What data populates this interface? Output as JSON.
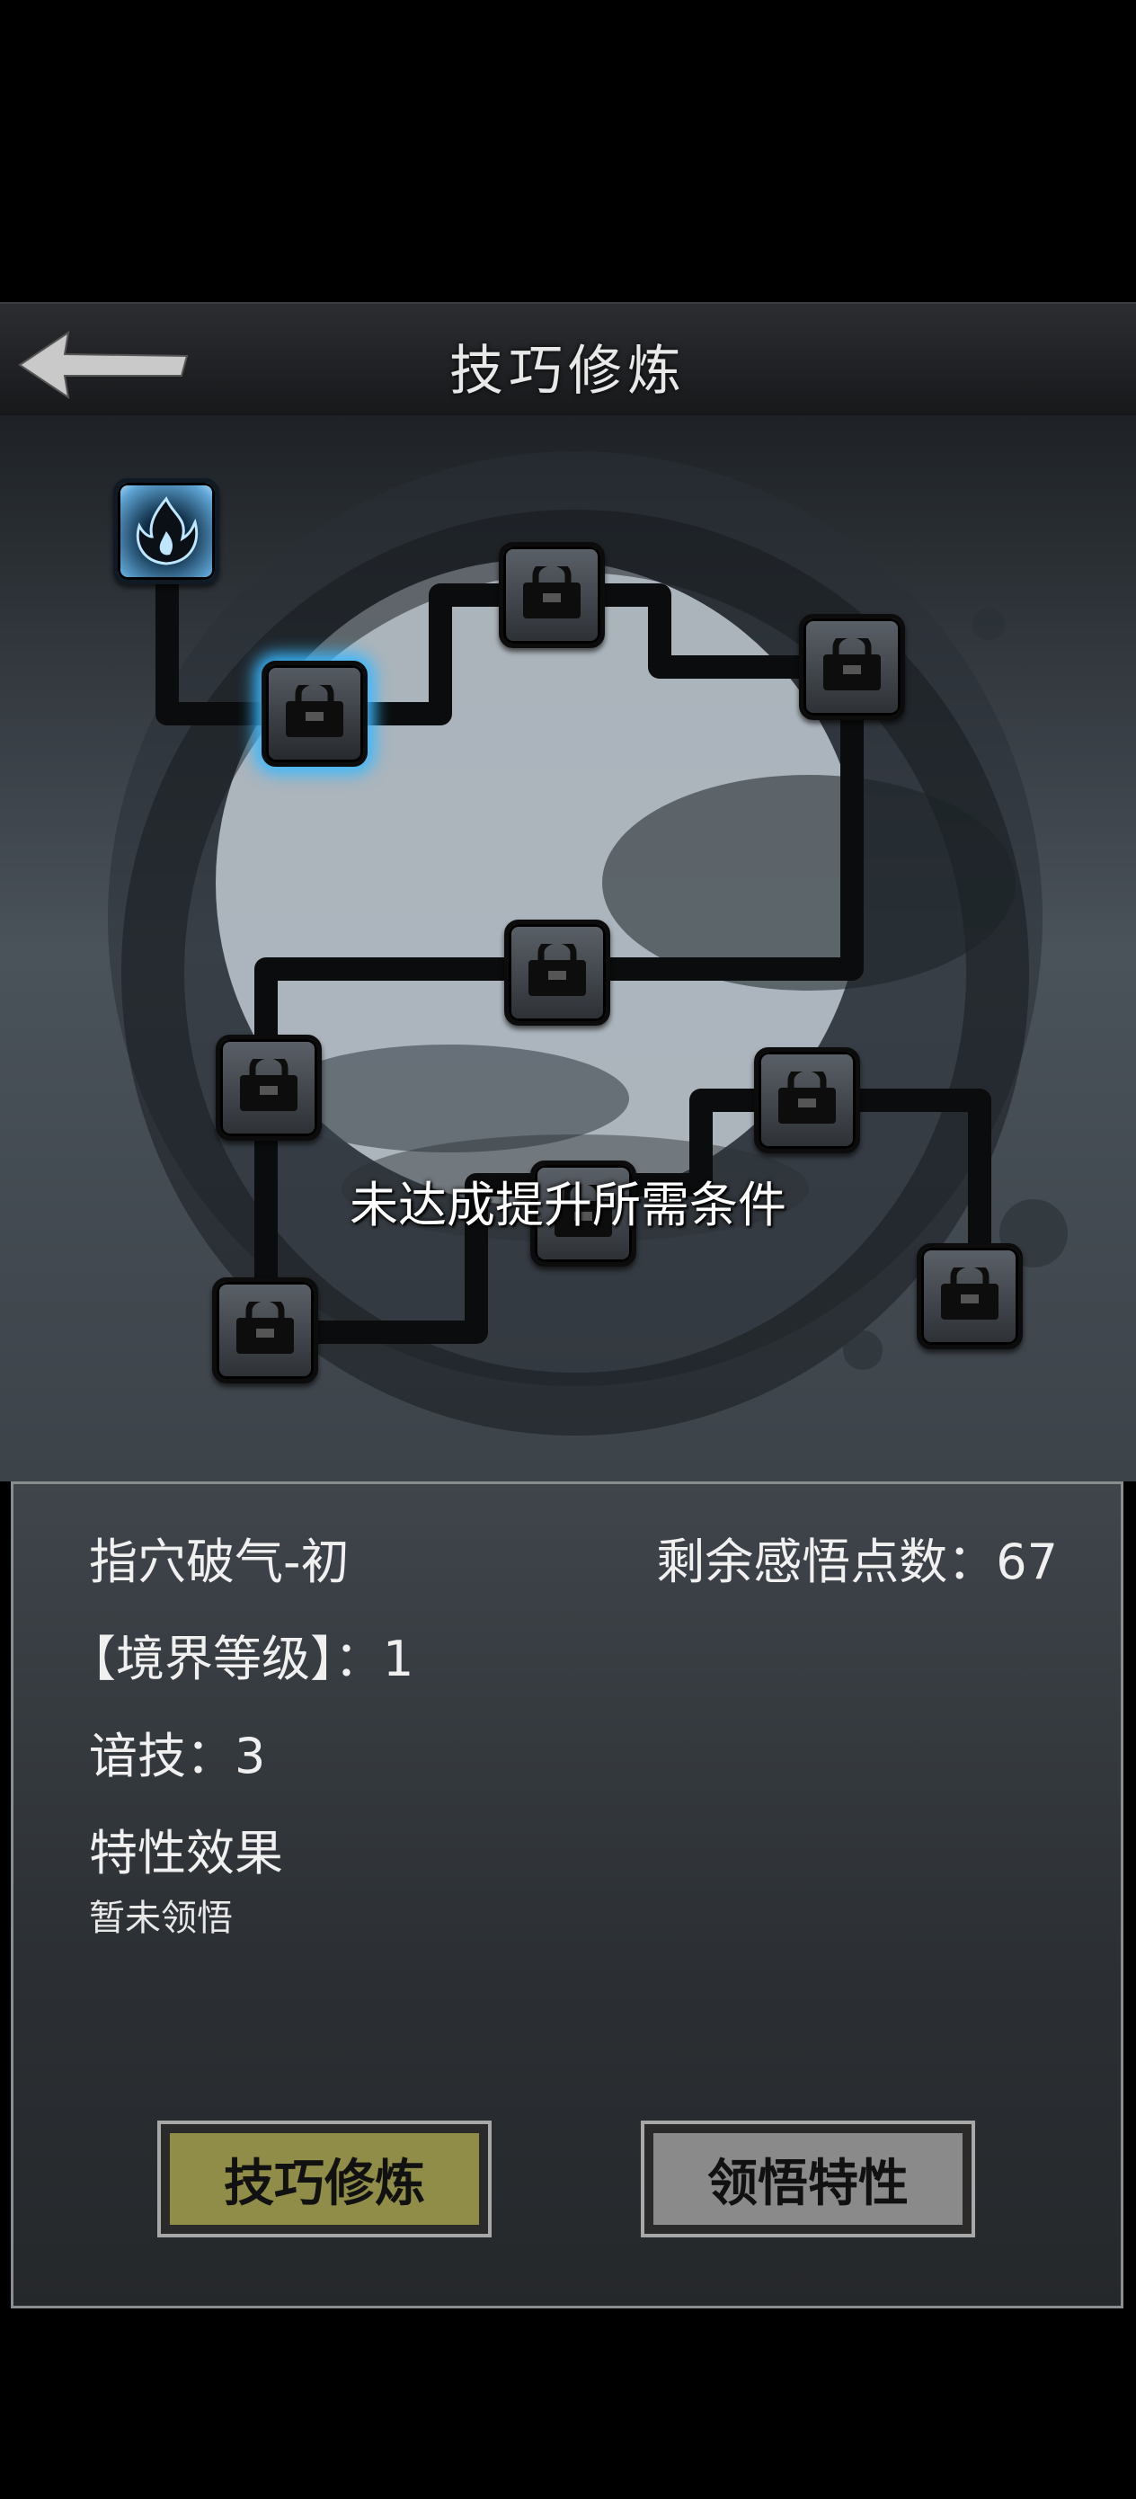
{
  "header": {
    "title": "技巧修炼",
    "back_icon": "back-arrow-icon"
  },
  "map": {
    "toast": "未达成提升所需条件",
    "nodes": [
      {
        "id": "root",
        "icon": "flame-icon",
        "state": "unlocked"
      },
      {
        "id": "n1",
        "icon": "lock-icon",
        "state": "selected"
      },
      {
        "id": "n2",
        "icon": "lock-icon",
        "state": "locked"
      },
      {
        "id": "n3",
        "icon": "lock-icon",
        "state": "locked"
      },
      {
        "id": "n4",
        "icon": "lock-icon",
        "state": "locked"
      },
      {
        "id": "n5",
        "icon": "lock-icon",
        "state": "locked"
      },
      {
        "id": "n6",
        "icon": "lock-icon",
        "state": "locked"
      },
      {
        "id": "n7",
        "icon": "lock-icon",
        "state": "locked"
      },
      {
        "id": "n8",
        "icon": "lock-icon",
        "state": "locked"
      },
      {
        "id": "n9",
        "icon": "lock-icon",
        "state": "locked"
      }
    ]
  },
  "panel": {
    "skill_name": "指穴破气-初",
    "points_label": "剩余感悟点数：67",
    "realm_level": "【境界等级】：1",
    "skill_stat": "谙技：3",
    "effect_title": "特性效果",
    "effect_text": "暂未领悟",
    "btn_train": "技巧修炼",
    "btn_comprehend": "领悟特性"
  },
  "colors": {
    "active_glow": "#39b9ff",
    "train_button": "#8f8d47",
    "comprehend_button": "#8a8a8a"
  }
}
